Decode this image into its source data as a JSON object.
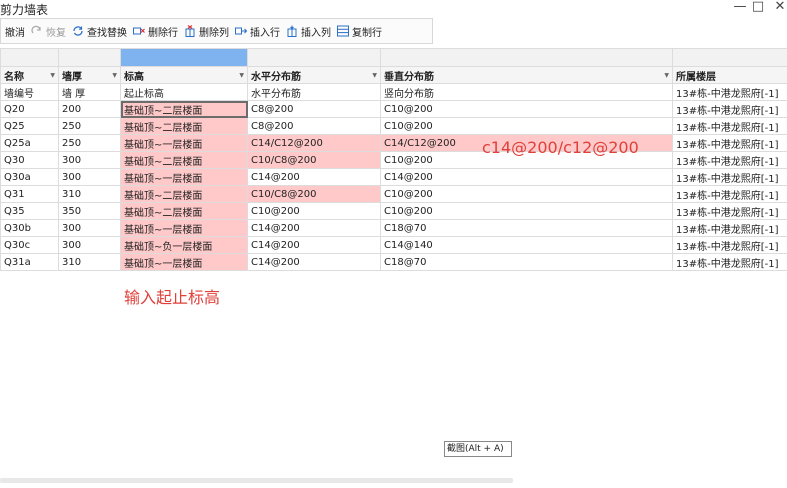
{
  "window": {
    "title": "剪力墙表",
    "minimize_glyph": "—",
    "maximize_glyph": "□",
    "close_glyph": "✕"
  },
  "toolbar": {
    "undo": "撤消",
    "redo": "恢复",
    "find_replace": "查找替换",
    "delete_row": "删除行",
    "delete_col": "删除列",
    "insert_row": "插入行",
    "insert_col": "插入列",
    "copy_row": "复制行"
  },
  "table": {
    "headers": [
      "名称",
      "墙厚",
      "标高",
      "水平分布筋",
      "垂直分布筋",
      "所属楼层"
    ],
    "descriptions": [
      "墙编号",
      "墙 厚",
      "起止标高",
      "水平分布筋",
      "竖向分布筋",
      "13#栋-中港龙熙府[-1]"
    ],
    "rows": [
      [
        "Q20",
        "200",
        "基础顶~二层楼面",
        "C8@200",
        "C10@200",
        "13#栋-中港龙熙府[-1]"
      ],
      [
        "Q25",
        "250",
        "基础顶~二层楼面",
        "C8@200",
        "C10@200",
        "13#栋-中港龙熙府[-1]"
      ],
      [
        "Q25a",
        "250",
        "基础顶~一层楼面",
        "C14/C12@200",
        "C14/C12@200",
        "13#栋-中港龙熙府[-1]"
      ],
      [
        "Q30",
        "300",
        "基础顶~二层楼面",
        "C10/C8@200",
        "C10@200",
        "13#栋-中港龙熙府[-1]"
      ],
      [
        "Q30a",
        "300",
        "基础顶~一层楼面",
        "C14@200",
        "C14@200",
        "13#栋-中港龙熙府[-1]"
      ],
      [
        "Q31",
        "310",
        "基础顶~二层楼面",
        "C10/C8@200",
        "C10@200",
        "13#栋-中港龙熙府[-1]"
      ],
      [
        "Q35",
        "350",
        "基础顶~二层楼面",
        "C10@200",
        "C10@200",
        "13#栋-中港龙熙府[-1]"
      ],
      [
        "Q30b",
        "300",
        "基础顶~一层楼面",
        "C14@200",
        "C18@70",
        "13#栋-中港龙熙府[-1]"
      ],
      [
        "Q30c",
        "300",
        "基础顶~负一层楼面",
        "C14@200",
        "C14@140",
        "13#栋-中港龙熙府[-1]"
      ],
      [
        "Q31a",
        "310",
        "基础顶~一层楼面",
        "C14@200",
        "C18@70",
        "13#栋-中港龙熙府[-1]"
      ]
    ]
  },
  "annotations": {
    "rebar_note": "c14@200/c12@200",
    "elevation_note": "输入起止标高"
  },
  "tooltip": "截图(Alt + A)",
  "colors": {
    "highlight": "#ffc9c9",
    "annotation": "#e0403a",
    "selected_column": "#7fb3f0"
  }
}
